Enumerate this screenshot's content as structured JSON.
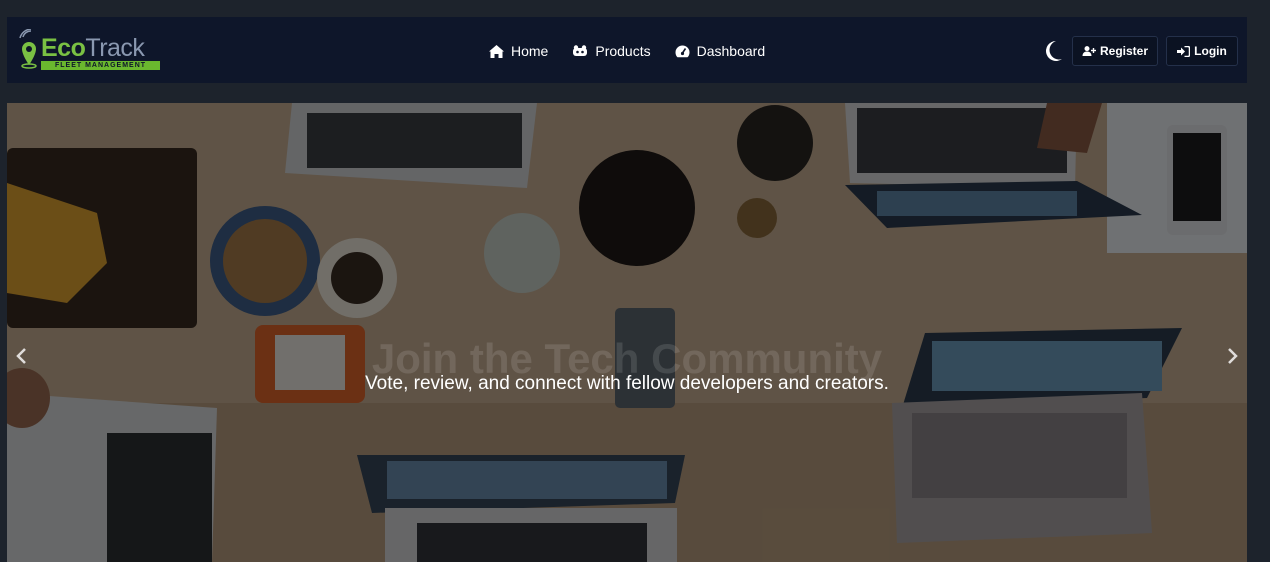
{
  "brand": {
    "name_primary": "Eco",
    "name_secondary": "Track",
    "tagline": "FLEET MANAGEMENT",
    "colors": {
      "green": "#7ac143",
      "grey": "#8a98b0"
    }
  },
  "nav": {
    "links": [
      {
        "label": "Home",
        "icon": "home-icon"
      },
      {
        "label": "Products",
        "icon": "products-icon"
      },
      {
        "label": "Dashboard",
        "icon": "dashboard-icon"
      }
    ],
    "theme_toggle_icon": "moon-icon",
    "register_label": "Register",
    "login_label": "Login"
  },
  "hero": {
    "title": "Join the Tech Community",
    "subtitle": "Vote, review, and connect with fellow developers and creators.",
    "prev_icon": "chevron-left-icon",
    "next_icon": "chevron-right-icon"
  },
  "colors": {
    "page_bg": "#1d232c",
    "navbar_bg": "#0e162a",
    "text": "#ffffff"
  }
}
